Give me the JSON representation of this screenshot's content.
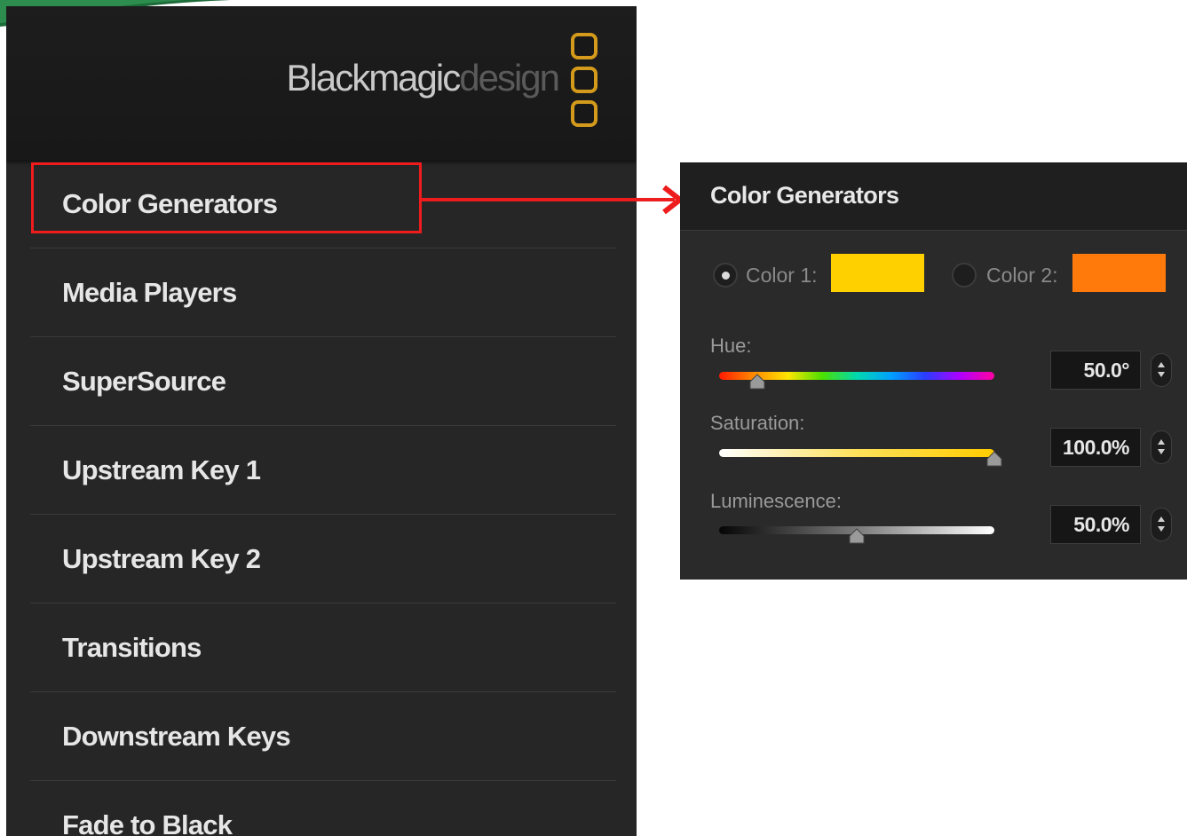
{
  "brand": {
    "name_primary": "Blackmagic",
    "name_secondary": "design",
    "accent_color": "#d49a1b"
  },
  "sidebar": {
    "items": [
      {
        "label": "Color Generators"
      },
      {
        "label": "Media Players"
      },
      {
        "label": "SuperSource"
      },
      {
        "label": "Upstream Key 1"
      },
      {
        "label": "Upstream Key 2"
      },
      {
        "label": "Transitions"
      },
      {
        "label": "Downstream Keys"
      },
      {
        "label": "Fade to Black"
      }
    ],
    "highlighted_item": "Color Generators",
    "highlight_color": "#ee1c1c"
  },
  "panel": {
    "title": "Color Generators",
    "color1": {
      "label": "Color 1:",
      "swatch": "#ffd000",
      "selected": true
    },
    "color2": {
      "label": "Color 2:",
      "swatch": "#ff7a0a",
      "selected": false
    },
    "hue": {
      "label": "Hue:",
      "value": "50.0°",
      "level": 0.14
    },
    "saturation": {
      "label": "Saturation:",
      "value": "100.0%",
      "level": 1.0
    },
    "luminescence": {
      "label": "Luminescence:",
      "value": "50.0%",
      "level": 0.5
    }
  }
}
